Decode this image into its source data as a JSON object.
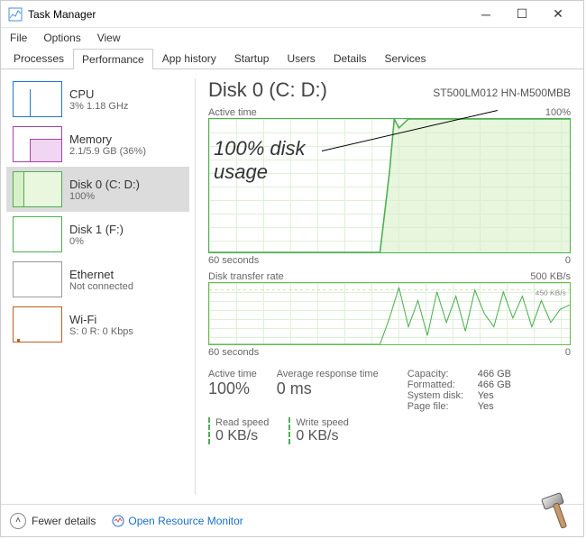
{
  "window": {
    "title": "Task Manager"
  },
  "menu": {
    "file": "File",
    "options": "Options",
    "view": "View"
  },
  "tabs": {
    "processes": "Processes",
    "performance": "Performance",
    "app_history": "App history",
    "startup": "Startup",
    "users": "Users",
    "details": "Details",
    "services": "Services"
  },
  "sidebar": {
    "items": [
      {
        "title": "CPU",
        "sub": "3%  1.18 GHz",
        "type": "cpu"
      },
      {
        "title": "Memory",
        "sub": "2.1/5.9 GB (36%)",
        "type": "mem"
      },
      {
        "title": "Disk 0 (C: D:)",
        "sub": "100%",
        "type": "disk",
        "selected": true
      },
      {
        "title": "Disk 1 (F:)",
        "sub": "0%",
        "type": "disk"
      },
      {
        "title": "Ethernet",
        "sub": "Not connected",
        "type": "eth"
      },
      {
        "title": "Wi-Fi",
        "sub": "S: 0 R: 0 Kbps",
        "type": "wifi"
      }
    ]
  },
  "main": {
    "title": "Disk 0 (C: D:)",
    "subtitle": "ST500LM012 HN-M500MBB",
    "graph1": {
      "label": "Active time",
      "max": "100%",
      "xstart": "60 seconds",
      "xend": "0"
    },
    "graph2": {
      "label": "Disk transfer rate",
      "max": "500 KB/s",
      "marker": "450 KB/s",
      "xstart": "60 seconds",
      "xend": "0"
    },
    "stats": {
      "active_time_label": "Active time",
      "active_time_value": "100%",
      "avg_resp_label": "Average response time",
      "avg_resp_value": "0 ms",
      "read_label": "Read speed",
      "read_value": "0 KB/s",
      "write_label": "Write speed",
      "write_value": "0 KB/s"
    },
    "info": {
      "capacity_k": "Capacity:",
      "capacity_v": "466 GB",
      "formatted_k": "Formatted:",
      "formatted_v": "466 GB",
      "system_k": "System disk:",
      "system_v": "Yes",
      "page_k": "Page file:",
      "page_v": "Yes"
    }
  },
  "footer": {
    "fewer": "Fewer details",
    "orm": "Open Resource Monitor"
  },
  "annotation": {
    "line1": "100% disk",
    "line2": "usage"
  },
  "chart_data": [
    {
      "type": "line",
      "title": "Active time",
      "ylabel": "%",
      "ylim": [
        0,
        100
      ],
      "xlabel": "seconds",
      "xlim": [
        60,
        0
      ],
      "x": [
        60,
        55,
        50,
        45,
        40,
        35,
        30,
        28,
        26,
        24,
        22,
        20,
        15,
        10,
        5,
        0
      ],
      "values": [
        0,
        0,
        0,
        0,
        0,
        0,
        0,
        60,
        100,
        95,
        100,
        100,
        100,
        100,
        100,
        100
      ]
    },
    {
      "type": "line",
      "title": "Disk transfer rate",
      "ylabel": "KB/s",
      "ylim": [
        0,
        500
      ],
      "xlabel": "seconds",
      "xlim": [
        60,
        0
      ],
      "marker": 450,
      "x": [
        60,
        50,
        40,
        35,
        30,
        28,
        26,
        24,
        22,
        20,
        18,
        16,
        14,
        12,
        10,
        8,
        6,
        4,
        2,
        0
      ],
      "values": [
        0,
        0,
        0,
        0,
        0,
        200,
        450,
        100,
        300,
        50,
        400,
        200,
        350,
        150,
        450,
        300,
        200,
        400,
        250,
        350
      ]
    }
  ]
}
